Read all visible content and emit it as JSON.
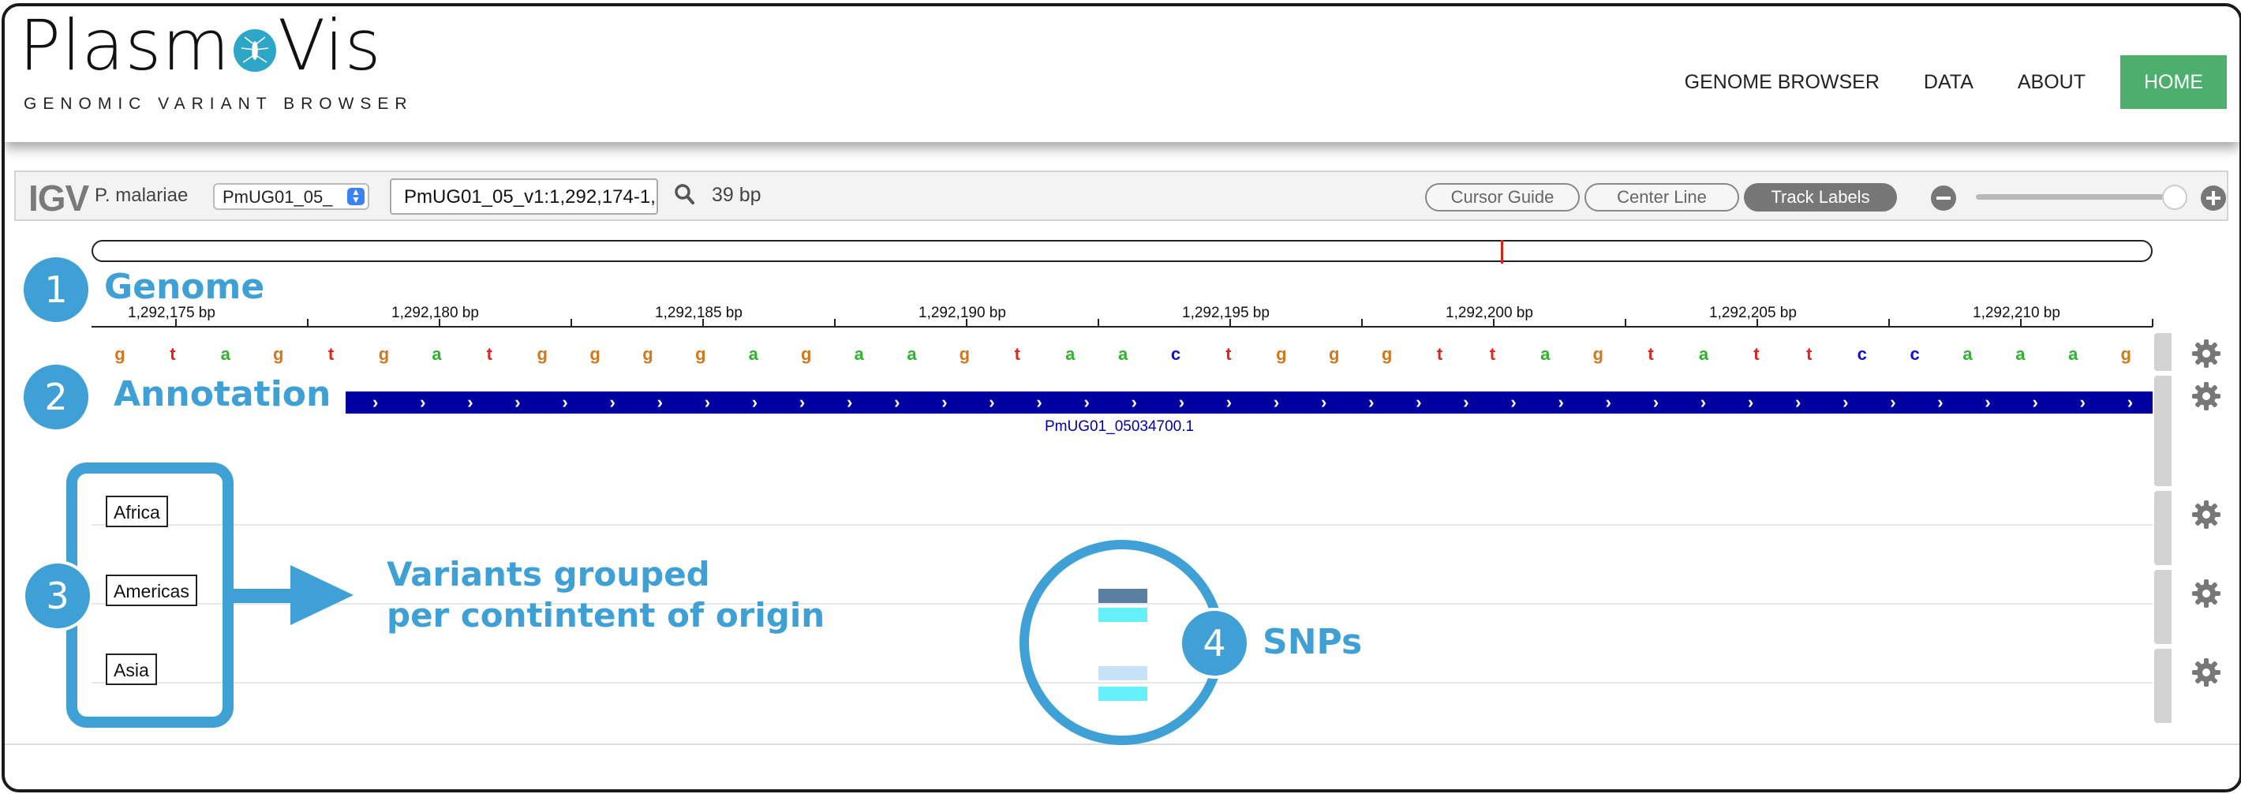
{
  "header": {
    "logo_part1": "Plasm",
    "logo_part2": "Vis",
    "logo_subtitle": "GENOMIC VARIANT BROWSER",
    "nav": [
      "GENOME BROWSER",
      "DATA",
      "ABOUT",
      "HOME"
    ],
    "nav_active": "HOME",
    "accent_color": "#4caf6e"
  },
  "igv": {
    "logo": "IGV",
    "genome": "P. malariae",
    "chromosome": "PmUG01_05_",
    "locus": "PmUG01_05_v1:1,292,174-1,",
    "bp_count": "39 bp",
    "buttons": [
      "Cursor Guide",
      "Center Line",
      "Track Labels"
    ],
    "active_button": "Track Labels",
    "ruler_labels": [
      "1,292,175 bp",
      "1,292,180 bp",
      "1,292,185 bp",
      "1,292,190 bp",
      "1,292,195 bp",
      "1,292,200 bp",
      "1,292,205 bp",
      "1,292,210 bp"
    ],
    "sequence": [
      "g",
      "t",
      "a",
      "g",
      "t",
      "g",
      "a",
      "t",
      "g",
      "g",
      "g",
      "g",
      "a",
      "g",
      "a",
      "a",
      "g",
      "t",
      "a",
      "a",
      "c",
      "t",
      "g",
      "g",
      "g",
      "t",
      "t",
      "a",
      "g",
      "t",
      "a",
      "t",
      "t",
      "c",
      "c",
      "a",
      "a",
      "a",
      "g"
    ],
    "base_colors": {
      "a": "#2fb32f",
      "c": "#1010c8",
      "g": "#d1781f",
      "t": "#e0241f"
    },
    "gene_label": "PmUG01_05034700.1",
    "populations": [
      "Africa",
      "Americas",
      "Asia"
    ]
  },
  "annotations": {
    "badge1": "1",
    "badge2": "2",
    "badge3": "3",
    "badge4": "4",
    "genome": "Genome",
    "annotation": "Annotation",
    "variants_line1": "Variants grouped",
    "variants_line2": "per contintent of origin",
    "snps": "SNPs",
    "callout_color": "#3ea0d4"
  },
  "snp_colors": [
    "#5b7fa1",
    "#66f0fa",
    "#c6e2f7",
    "#66f0fa"
  ]
}
